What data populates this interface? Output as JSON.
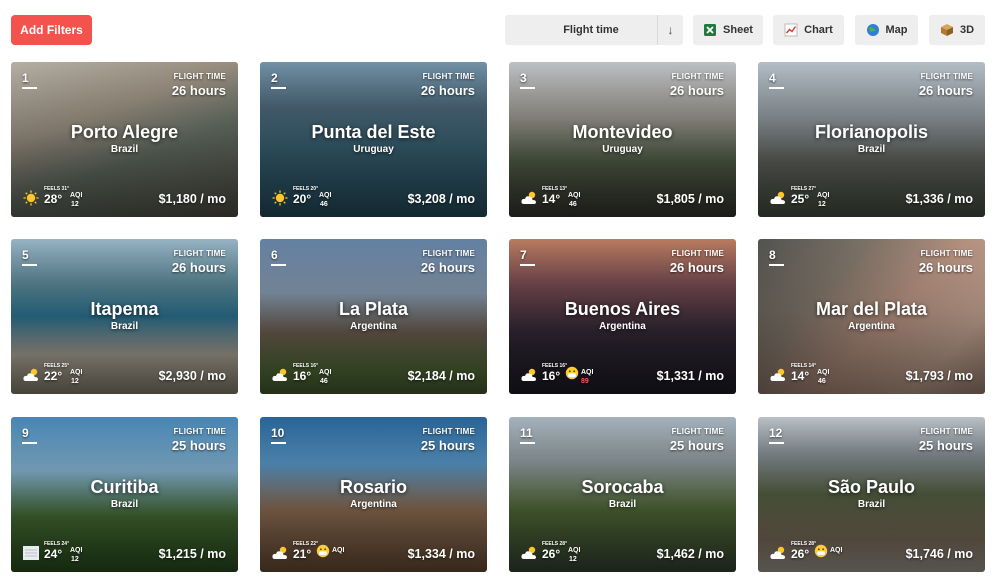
{
  "toolbar": {
    "add_filters": "Add Filters",
    "sort_label": "Flight time",
    "sort_arrow": "↓",
    "sheet": "Sheet",
    "chart": "Chart",
    "map": "Map",
    "three_d": "3D"
  },
  "colors": {
    "accent": "#f4524d",
    "button_bg": "#eeeeee"
  },
  "card_labels": {
    "flight_time": "FLIGHT TIME",
    "aqi": "AQI"
  },
  "cards": [
    {
      "rank": "1",
      "city": "Porto Alegre",
      "country": "Brazil",
      "flight_time": "26 hours",
      "feels": "FEELS 31°",
      "temp": "28°",
      "aqi": "12",
      "price": "$1,180 / mo",
      "weather": "sun-icon",
      "aqi_icon": ""
    },
    {
      "rank": "2",
      "city": "Punta del Este",
      "country": "Uruguay",
      "flight_time": "26 hours",
      "feels": "FEELS 20°",
      "temp": "20°",
      "aqi": "46",
      "price": "$3,208 / mo",
      "weather": "sun-icon",
      "aqi_icon": ""
    },
    {
      "rank": "3",
      "city": "Montevideo",
      "country": "Uruguay",
      "flight_time": "26 hours",
      "feels": "FEELS 13°",
      "temp": "14°",
      "aqi": "46",
      "price": "$1,805 / mo",
      "weather": "cloud-icon",
      "aqi_icon": ""
    },
    {
      "rank": "4",
      "city": "Florianopolis",
      "country": "Brazil",
      "flight_time": "26 hours",
      "feels": "FEELS 27°",
      "temp": "25°",
      "aqi": "12",
      "price": "$1,336 / mo",
      "weather": "cloud-icon",
      "aqi_icon": ""
    },
    {
      "rank": "5",
      "city": "Itapema",
      "country": "Brazil",
      "flight_time": "26 hours",
      "feels": "FEELS 25°",
      "temp": "22°",
      "aqi": "12",
      "price": "$2,930 / mo",
      "weather": "cloud-icon",
      "aqi_icon": ""
    },
    {
      "rank": "6",
      "city": "La Plata",
      "country": "Argentina",
      "flight_time": "26 hours",
      "feels": "FEELS 16°",
      "temp": "16°",
      "aqi": "46",
      "price": "$2,184 / mo",
      "weather": "cloud-icon",
      "aqi_icon": ""
    },
    {
      "rank": "7",
      "city": "Buenos Aires",
      "country": "Argentina",
      "flight_time": "26 hours",
      "feels": "FEELS 16°",
      "temp": "16°",
      "aqi": "89",
      "price": "$1,331 / mo",
      "weather": "cloud-icon",
      "aqi_icon": "mask-face-icon"
    },
    {
      "rank": "8",
      "city": "Mar del Plata",
      "country": "Argentina",
      "flight_time": "26 hours",
      "feels": "FEELS 14°",
      "temp": "14°",
      "aqi": "46",
      "price": "$1,793 / mo",
      "weather": "cloud-icon",
      "aqi_icon": ""
    },
    {
      "rank": "9",
      "city": "Curitiba",
      "country": "Brazil",
      "flight_time": "25 hours",
      "feels": "FEELS 24°",
      "temp": "24°",
      "aqi": "12",
      "price": "$1,215 / mo",
      "weather": "fog-icon",
      "aqi_icon": ""
    },
    {
      "rank": "10",
      "city": "Rosario",
      "country": "Argentina",
      "flight_time": "25 hours",
      "feels": "FEELS 22°",
      "temp": "21°",
      "aqi": "",
      "price": "$1,334 / mo",
      "weather": "cloud-icon",
      "aqi_icon": "mask-face-icon"
    },
    {
      "rank": "11",
      "city": "Sorocaba",
      "country": "Brazil",
      "flight_time": "25 hours",
      "feels": "FEELS 28°",
      "temp": "26°",
      "aqi": "12",
      "price": "$1,462 / mo",
      "weather": "cloud-icon",
      "aqi_icon": ""
    },
    {
      "rank": "12",
      "city": "São Paulo",
      "country": "Brazil",
      "flight_time": "25 hours",
      "feels": "FEELS 28°",
      "temp": "26°",
      "aqi": "",
      "price": "$1,746 / mo",
      "weather": "cloud-icon",
      "aqi_icon": "mask-face-icon"
    }
  ]
}
